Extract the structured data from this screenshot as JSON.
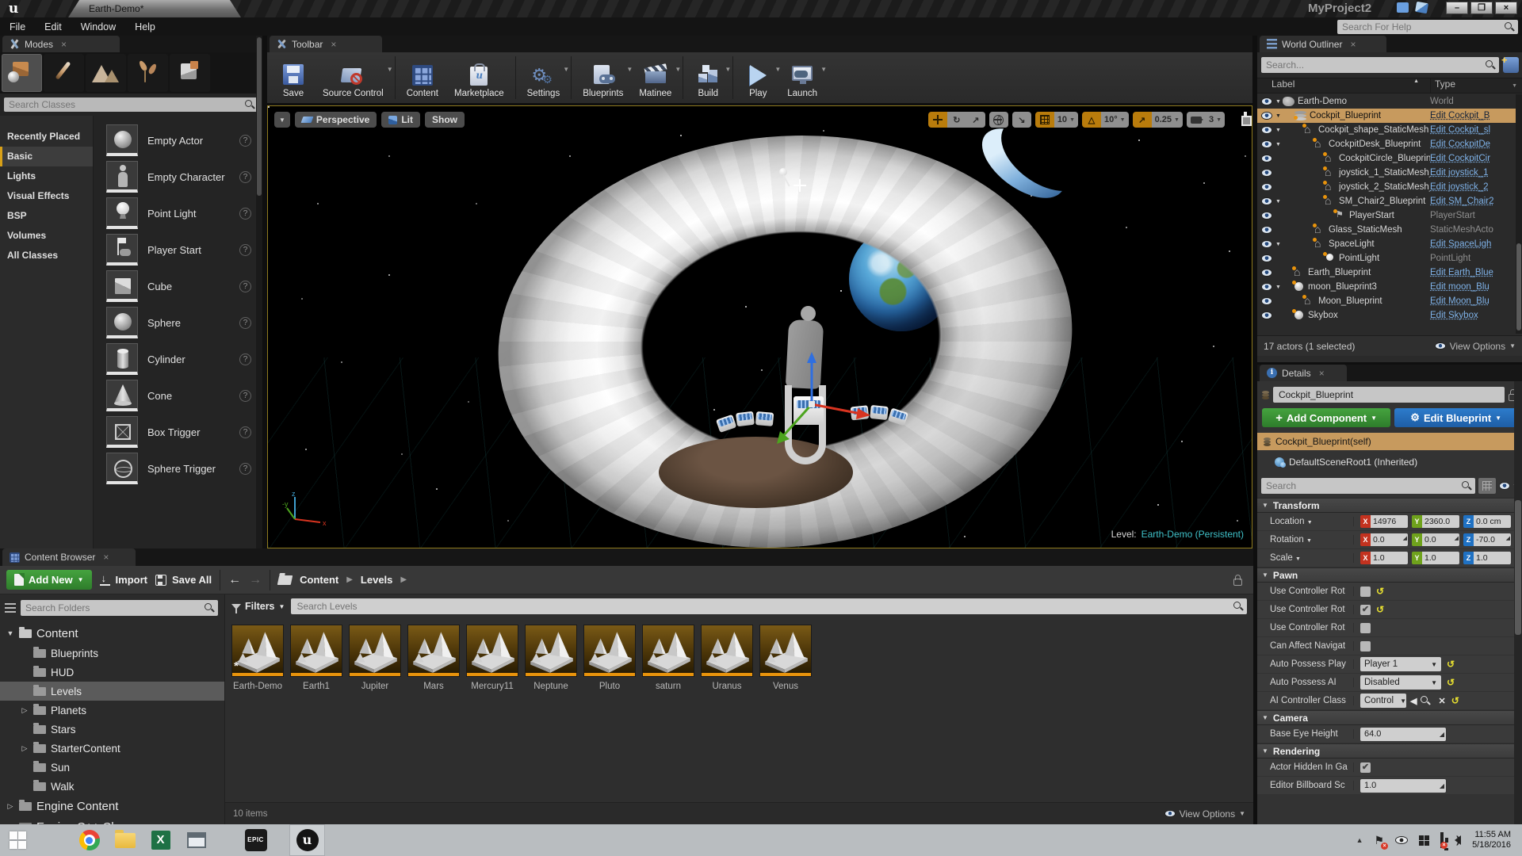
{
  "window": {
    "app_title": "MyProject2",
    "tab_title": "Earth-Demo*",
    "menu": [
      "File",
      "Edit",
      "Window",
      "Help"
    ],
    "help_search_placeholder": "Search For Help"
  },
  "modes": {
    "tab": "Modes",
    "mode_tabs": [
      "place",
      "paint",
      "landscape",
      "foliage",
      "geometry"
    ],
    "active_mode": "place",
    "search_placeholder": "Search Classes",
    "categories": [
      {
        "label": "Recently Placed",
        "selected": false
      },
      {
        "label": "Basic",
        "selected": true
      },
      {
        "label": "Lights",
        "selected": false
      },
      {
        "label": "Visual Effects",
        "selected": false
      },
      {
        "label": "BSP",
        "selected": false
      },
      {
        "label": "Volumes",
        "selected": false
      },
      {
        "label": "All Classes",
        "selected": false
      }
    ],
    "items": [
      {
        "label": "Empty Actor",
        "thumb": "sphere"
      },
      {
        "label": "Empty Character",
        "thumb": "character"
      },
      {
        "label": "Point Light",
        "thumb": "bulb"
      },
      {
        "label": "Player Start",
        "thumb": "flag"
      },
      {
        "label": "Cube",
        "thumb": "cube"
      },
      {
        "label": "Sphere",
        "thumb": "sphere"
      },
      {
        "label": "Cylinder",
        "thumb": "cylinder"
      },
      {
        "label": "Cone",
        "thumb": "cone"
      },
      {
        "label": "Box Trigger",
        "thumb": "box-wire"
      },
      {
        "label": "Sphere Trigger",
        "thumb": "sphere-wire"
      }
    ]
  },
  "toolbar": {
    "tab": "Toolbar",
    "buttons": [
      {
        "label": "Save",
        "icon": "save",
        "dropdown": false,
        "sep_after": false
      },
      {
        "label": "Source Control",
        "icon": "source-control",
        "dropdown": true,
        "sep_after": true
      },
      {
        "label": "Content",
        "icon": "content",
        "dropdown": false,
        "sep_after": false
      },
      {
        "label": "Marketplace",
        "icon": "marketplace",
        "dropdown": false,
        "sep_after": true
      },
      {
        "label": "Settings",
        "icon": "settings",
        "dropdown": true,
        "sep_after": true
      },
      {
        "label": "Blueprints",
        "icon": "blueprints",
        "dropdown": true,
        "sep_after": false
      },
      {
        "label": "Matinee",
        "icon": "matinee",
        "dropdown": true,
        "sep_after": true
      },
      {
        "label": "Build",
        "icon": "build",
        "dropdown": true,
        "sep_after": true
      },
      {
        "label": "Play",
        "icon": "play",
        "dropdown": true,
        "sep_after": false
      },
      {
        "label": "Launch",
        "icon": "launch",
        "dropdown": true,
        "sep_after": false
      }
    ]
  },
  "viewport": {
    "perspective_label": "Perspective",
    "lit_label": "Lit",
    "show_label": "Show",
    "grid_snap_value": "10",
    "rotation_snap_value": "10°",
    "scale_snap_value": "0.25",
    "camera_speed_value": "3",
    "level_label": "Level:",
    "level_name": "Earth-Demo (Persistent)"
  },
  "world_outliner": {
    "tab": "World Outliner",
    "search_placeholder": "Search...",
    "columns": {
      "label": "Label",
      "type": "Type"
    },
    "rows": [
      {
        "label": "Earth-Demo",
        "type": "World",
        "indent": 0,
        "icon": "world",
        "link": false,
        "selected": false,
        "twisty": true
      },
      {
        "label": "Cockpit_Blueprint",
        "type": "Edit Cockpit_B",
        "indent": 1,
        "icon": "bp",
        "link": true,
        "selected": true,
        "twisty": true
      },
      {
        "label": "Cockpit_shape_StaticMesh",
        "type": "Edit Cockpit_sl",
        "indent": 2,
        "icon": "house",
        "link": true,
        "selected": false,
        "twisty": true
      },
      {
        "label": "CockpitDesk_Blueprint",
        "type": "Edit CockpitDe",
        "indent": 3,
        "icon": "house",
        "link": true,
        "selected": false,
        "twisty": true
      },
      {
        "label": "CockpitCircle_Blueprin",
        "type": "Edit CockpitCir",
        "indent": 4,
        "icon": "house",
        "link": true,
        "selected": false,
        "twisty": false
      },
      {
        "label": "joystick_1_StaticMesh_",
        "type": "Edit joystick_1",
        "indent": 4,
        "icon": "house",
        "link": true,
        "selected": false,
        "twisty": false
      },
      {
        "label": "joystick_2_StaticMesh_",
        "type": "Edit joystick_2",
        "indent": 4,
        "icon": "house",
        "link": true,
        "selected": false,
        "twisty": false
      },
      {
        "label": "SM_Chair2_Blueprint",
        "type": "Edit SM_Chair2",
        "indent": 4,
        "icon": "house",
        "link": true,
        "selected": false,
        "twisty": true
      },
      {
        "label": "PlayerStart",
        "type": "PlayerStart",
        "indent": 5,
        "icon": "player",
        "link": false,
        "selected": false,
        "twisty": false
      },
      {
        "label": "Glass_StaticMesh",
        "type": "StaticMeshActo",
        "indent": 3,
        "icon": "house",
        "link": false,
        "selected": false,
        "twisty": false
      },
      {
        "label": "SpaceLight",
        "type": "Edit SpaceLigh",
        "indent": 3,
        "icon": "house",
        "link": true,
        "selected": false,
        "twisty": true
      },
      {
        "label": "PointLight",
        "type": "PointLight",
        "indent": 4,
        "icon": "light",
        "link": false,
        "selected": false,
        "twisty": false
      },
      {
        "label": "Earth_Blueprint",
        "type": "Edit Earth_Blue",
        "indent": 1,
        "icon": "house",
        "link": true,
        "selected": false,
        "twisty": false
      },
      {
        "label": "moon_Blueprint3",
        "type": "Edit moon_Blu",
        "indent": 1,
        "icon": "sphere",
        "link": true,
        "selected": false,
        "twisty": true
      },
      {
        "label": "Moon_Blueprint",
        "type": "Edit Moon_Blu",
        "indent": 2,
        "icon": "house",
        "link": true,
        "selected": false,
        "twisty": false
      },
      {
        "label": "Skybox",
        "type": "Edit Skybox",
        "indent": 1,
        "icon": "sphere",
        "link": true,
        "selected": false,
        "twisty": false
      }
    ],
    "footer": "17 actors (1 selected)",
    "view_options": "View Options"
  },
  "details": {
    "tab": "Details",
    "name_value": "Cockpit_Blueprint",
    "add_component": "Add Component",
    "edit_blueprint": "Edit Blueprint",
    "components": [
      {
        "label": "Cockpit_Blueprint(self)"
      },
      {
        "label": "DefaultSceneRoot1 (Inherited)"
      }
    ],
    "search_placeholder": "Search",
    "transform": {
      "title": "Transform",
      "rows": [
        {
          "label": "Location",
          "x": "14976",
          "y": "2360.0",
          "z": "0.0 cm",
          "reset": true,
          "lock": false,
          "slider": false
        },
        {
          "label": "Rotation",
          "x": "0.0",
          "y": "0.0",
          "z": "-70.0",
          "reset": true,
          "lock": false,
          "slider": true
        },
        {
          "label": "Scale",
          "x": "1.0",
          "y": "1.0",
          "z": "1.0",
          "reset": false,
          "lock": true,
          "slider": false
        }
      ]
    },
    "pawn": {
      "title": "Pawn",
      "rows": [
        {
          "label": "Use Controller Rot",
          "control": "checkbox",
          "checked": false,
          "reset": true
        },
        {
          "label": "Use Controller Rot",
          "control": "checkbox",
          "checked": true,
          "reset": true
        },
        {
          "label": "Use Controller Rot",
          "control": "checkbox",
          "checked": false,
          "reset": false
        },
        {
          "label": "Can Affect Navigat",
          "control": "checkbox",
          "checked": false,
          "reset": false
        },
        {
          "label": "Auto Possess Play",
          "control": "select",
          "value": "Player 1",
          "reset": true
        },
        {
          "label": "Auto Possess AI",
          "control": "select",
          "value": "Disabled",
          "reset": true
        },
        {
          "label": "AI Controller Class",
          "control": "class",
          "value": "Control",
          "reset": true
        }
      ]
    },
    "camera": {
      "title": "Camera",
      "rows": [
        {
          "label": "Base Eye Height",
          "control": "number",
          "value": "64.0",
          "reset": false
        }
      ]
    },
    "rendering": {
      "title": "Rendering",
      "rows": [
        {
          "label": "Actor Hidden In Ga",
          "control": "checkbox",
          "checked": true,
          "reset": false
        },
        {
          "label": "Editor Billboard Sc",
          "control": "number",
          "value": "1.0",
          "reset": false
        }
      ]
    }
  },
  "content_browser": {
    "tab": "Content Browser",
    "add_new": "Add New",
    "import": "Import",
    "save_all": "Save All",
    "breadcrumb": [
      "Content",
      "Levels"
    ],
    "search_folders_placeholder": "Search Folders",
    "filters": "Filters",
    "search_assets_placeholder": "Search Levels",
    "folders": [
      {
        "label": "Content",
        "indent": 0,
        "root": true,
        "twisty": "open",
        "selected": false,
        "icon": "folder-open"
      },
      {
        "label": "Blueprints",
        "indent": 1,
        "root": false,
        "twisty": "none",
        "selected": false,
        "icon": "folder"
      },
      {
        "label": "HUD",
        "indent": 1,
        "root": false,
        "twisty": "none",
        "selected": false,
        "icon": "folder"
      },
      {
        "label": "Levels",
        "indent": 1,
        "root": false,
        "twisty": "none",
        "selected": true,
        "icon": "folder"
      },
      {
        "label": "Planets",
        "indent": 1,
        "root": false,
        "twisty": "closed",
        "selected": false,
        "icon": "folder"
      },
      {
        "label": "Stars",
        "indent": 1,
        "root": false,
        "twisty": "none",
        "selected": false,
        "icon": "folder"
      },
      {
        "label": "StarterContent",
        "indent": 1,
        "root": false,
        "twisty": "closed",
        "selected": false,
        "icon": "folder"
      },
      {
        "label": "Sun",
        "indent": 1,
        "root": false,
        "twisty": "none",
        "selected": false,
        "icon": "folder"
      },
      {
        "label": "Walk",
        "indent": 1,
        "root": false,
        "twisty": "none",
        "selected": false,
        "icon": "folder"
      },
      {
        "label": "Engine Content",
        "indent": 0,
        "root": true,
        "twisty": "closed",
        "selected": false,
        "icon": "folder"
      },
      {
        "label": "Engine C++ Classes",
        "indent": 0,
        "root": true,
        "twisty": "closed",
        "selected": false,
        "icon": "cpp"
      }
    ],
    "assets": [
      {
        "name": "Earth-Demo",
        "modified": true
      },
      {
        "name": "Earth1",
        "modified": false
      },
      {
        "name": "Jupiter",
        "modified": false
      },
      {
        "name": "Mars",
        "modified": false
      },
      {
        "name": "Mercury11",
        "modified": false
      },
      {
        "name": "Neptune",
        "modified": false
      },
      {
        "name": "Pluto",
        "modified": false
      },
      {
        "name": "saturn",
        "modified": false
      },
      {
        "name": "Uranus",
        "modified": false
      },
      {
        "name": "Venus",
        "modified": false
      }
    ],
    "item_count": "10 items",
    "view_options": "View Options"
  },
  "taskbar": {
    "icons": [
      "start",
      "chrome",
      "file-explorer",
      "excel",
      "window",
      "epic-launcher",
      "unreal-editor"
    ],
    "tray_icons": [
      "hidden-icons",
      "action-flag",
      "eye",
      "windows",
      "network",
      "volume"
    ],
    "time": "11:55 AM",
    "date": "5/18/2016"
  },
  "colors": {
    "accent_orange": "#e8930c",
    "selection_tan": "#c79a5e",
    "add_component_green": "#3a9e3a",
    "edit_blueprint_blue": "#2d7ccc",
    "link_blue": "#7fb2e8",
    "level_cyan": "#3fc1c9",
    "axis_x_red": "#c3321f",
    "axis_y_green": "#6fa21c",
    "axis_z_blue": "#1f71c3"
  }
}
